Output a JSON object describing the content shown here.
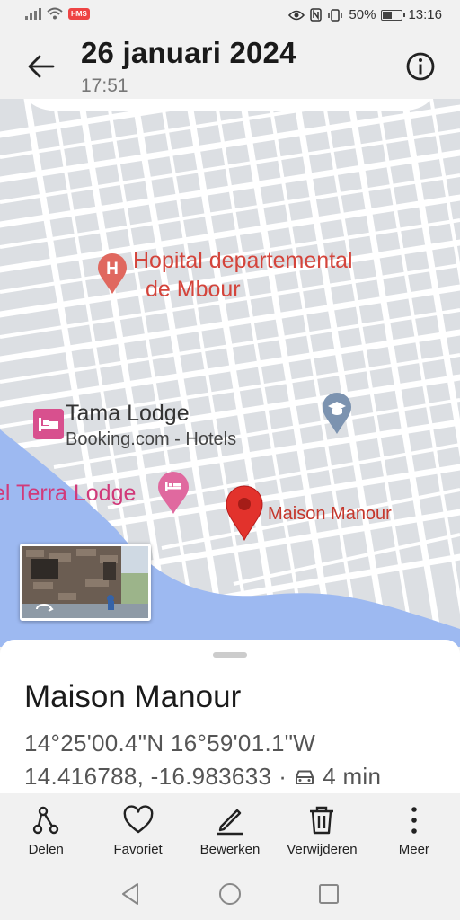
{
  "status_bar": {
    "battery_text": "50%",
    "clock": "13:16",
    "badge": "HMS",
    "battery_level": 0.5
  },
  "header": {
    "title": "26 januari 2024",
    "time": "17:51"
  },
  "map": {
    "labels": {
      "hospital_line1": "Hopital departemental",
      "hospital_line2": "de Mbour",
      "tama_lodge": "Tama Lodge",
      "tama_lodge_sub": "Booking.com - Hotels",
      "terra_lodge": "el Terra Lodge",
      "maison_pin": "Maison Manour"
    }
  },
  "details": {
    "name": "Maison Manour",
    "coords_dms": "14°25'00.4\"N 16°59'01.1\"W",
    "coords_decimal": "14.416788, -16.983633",
    "separator": "·",
    "drive_time": "4 min"
  },
  "actions": [
    {
      "label": "Delen",
      "icon": "share-icon"
    },
    {
      "label": "Favoriet",
      "icon": "heart-icon"
    },
    {
      "label": "Bewerken",
      "icon": "edit-icon"
    },
    {
      "label": "Verwijderen",
      "icon": "trash-icon"
    },
    {
      "label": "Meer",
      "icon": "more-icon"
    }
  ],
  "colors": {
    "hospital": "#d4443b",
    "hotel": "#d13a7a",
    "pin": "#e2322c",
    "water": "#9db9f1"
  }
}
